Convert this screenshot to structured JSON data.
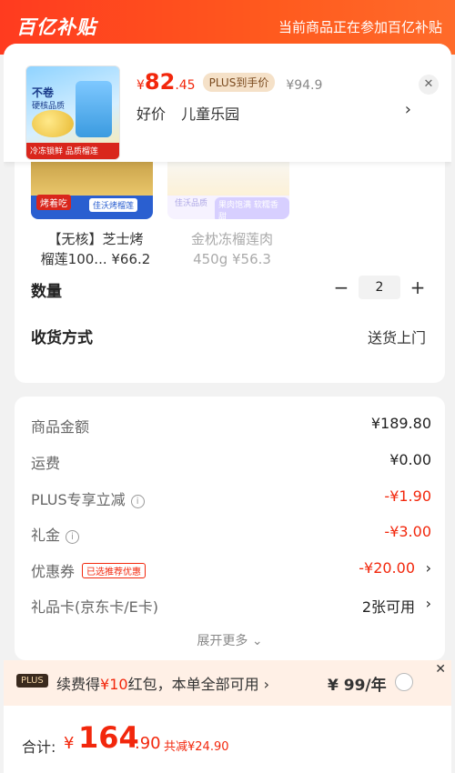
{
  "banner": {
    "logo": "百亿补贴",
    "note": "当前商品正在参加百亿补贴"
  },
  "product": {
    "price_symbol": "¥",
    "price_int": "82",
    "price_dec": ".45",
    "plus_tag": "PLUS到手价",
    "orig_price": "¥94.9",
    "tags": [
      "好价",
      "儿童乐园"
    ],
    "thumb_texts": [
      "不卷",
      "硬核品质",
      "冷冻锁鲜 品质榴莲"
    ]
  },
  "related": [
    {
      "badge": "烤着吃",
      "sub": "佳沃烤榴莲",
      "title": "【无核】芝士烤",
      "line2": "榴莲100... ¥66.2"
    },
    {
      "badge": "佳沃品质",
      "sub": "果肉饱满 软糯香甜",
      "title": "金枕冻榴莲肉",
      "line2": "450g ¥56.3"
    }
  ],
  "quantity": {
    "label": "数量",
    "value": "2",
    "minus": "−",
    "plus": "+"
  },
  "shipping": {
    "label": "收货方式",
    "value": "送货上门"
  },
  "fees": [
    {
      "label": "商品金额",
      "value": "¥189.80"
    },
    {
      "label": "运费",
      "value": "¥0.00"
    },
    {
      "label": "PLUS专享立减",
      "value": "-¥1.90"
    },
    {
      "label": "礼金",
      "value": "-¥3.00"
    },
    {
      "label": "优惠券",
      "badge": "已选推荐优惠",
      "value": "-¥20.00"
    },
    {
      "label": "礼品卡(京东卡/E卡)",
      "value": "2张可用"
    }
  ],
  "expand_label": "展开更多",
  "plus_offer": {
    "logo": "PLUS",
    "text_a": "续费得",
    "text_hl": "¥10",
    "text_b": "红包，本单全部可用 ›",
    "price": "¥ 99/年"
  },
  "footer": {
    "label": "合计:",
    "symbol": "¥",
    "int": "164",
    "dec": ".90",
    "saving": "共减¥24.90"
  },
  "colors": {
    "accent": "#f2270c",
    "banner": "#ff3b1f"
  }
}
